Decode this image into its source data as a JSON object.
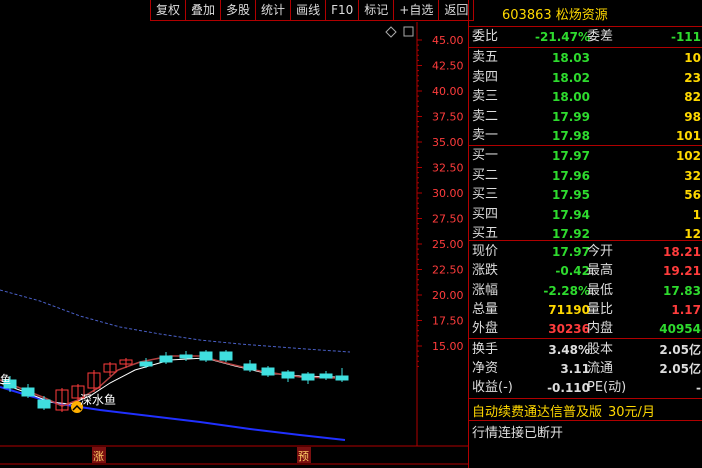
{
  "toolbar": [
    "复权",
    "叠加",
    "多股",
    "统计",
    "画线",
    "F10",
    "标记",
    "+自选",
    "返回"
  ],
  "chart": {
    "y_ticks": [
      "45.00",
      "42.50",
      "40.00",
      "37.50",
      "35.00",
      "32.50",
      "30.00",
      "27.50",
      "25.00",
      "22.50",
      "20.00",
      "17.50",
      "15.00"
    ],
    "annotation": "深水鱼",
    "left_label": "鱼",
    "bottom_markers": [
      "涨",
      "预"
    ],
    "colors": {
      "up": "#ff3c3c",
      "down": "#40e0e0",
      "ma_white": "#ffffff",
      "ma_blue": "#2030ff",
      "grid": "#b00000"
    }
  },
  "stock": {
    "code": "603863",
    "name": "松炀资源"
  },
  "wei": {
    "wb_label": "委比",
    "wb_value": "-21.47%",
    "wc_label": "委差",
    "wc_value": "-111"
  },
  "asks": [
    {
      "label": "卖五",
      "price": "18.03",
      "vol": "10"
    },
    {
      "label": "卖四",
      "price": "18.02",
      "vol": "23"
    },
    {
      "label": "卖三",
      "price": "18.00",
      "vol": "82"
    },
    {
      "label": "卖二",
      "price": "17.99",
      "vol": "98"
    },
    {
      "label": "卖一",
      "price": "17.98",
      "vol": "101"
    }
  ],
  "bids": [
    {
      "label": "买一",
      "price": "17.97",
      "vol": "102"
    },
    {
      "label": "买二",
      "price": "17.96",
      "vol": "32"
    },
    {
      "label": "买三",
      "price": "17.95",
      "vol": "56"
    },
    {
      "label": "买四",
      "price": "17.94",
      "vol": "1"
    },
    {
      "label": "买五",
      "price": "17.92",
      "vol": "12"
    }
  ],
  "quote": [
    {
      "l1": "现价",
      "v1": "17.97",
      "c1": "g",
      "l2": "今开",
      "v2": "18.21",
      "c2": "r"
    },
    {
      "l1": "涨跌",
      "v1": "-0.42",
      "c1": "g",
      "l2": "最高",
      "v2": "19.21",
      "c2": "r"
    },
    {
      "l1": "涨幅",
      "v1": "-2.28%",
      "c1": "g",
      "l2": "最低",
      "v2": "17.83",
      "c2": "g"
    },
    {
      "l1": "总量",
      "v1": "71190",
      "c1": "y",
      "l2": "量比",
      "v2": "1.17",
      "c2": "r"
    },
    {
      "l1": "外盘",
      "v1": "30236",
      "c1": "r",
      "l2": "内盘",
      "v2": "40954",
      "c2": "g"
    }
  ],
  "fund": [
    {
      "l1": "换手",
      "v1": "3.48%",
      "l2": "股本",
      "v2": "2.05亿"
    },
    {
      "l1": "净资",
      "v1": "3.11",
      "l2": "流通",
      "v2": "2.05亿"
    },
    {
      "l1": "收益(-)",
      "v1": "-0.110",
      "l2": "PE(动)",
      "v2": "-"
    }
  ],
  "promo": {
    "text": "自动续费通达信普及版",
    "price": "30元/月"
  },
  "status": "行情连接已断开"
}
